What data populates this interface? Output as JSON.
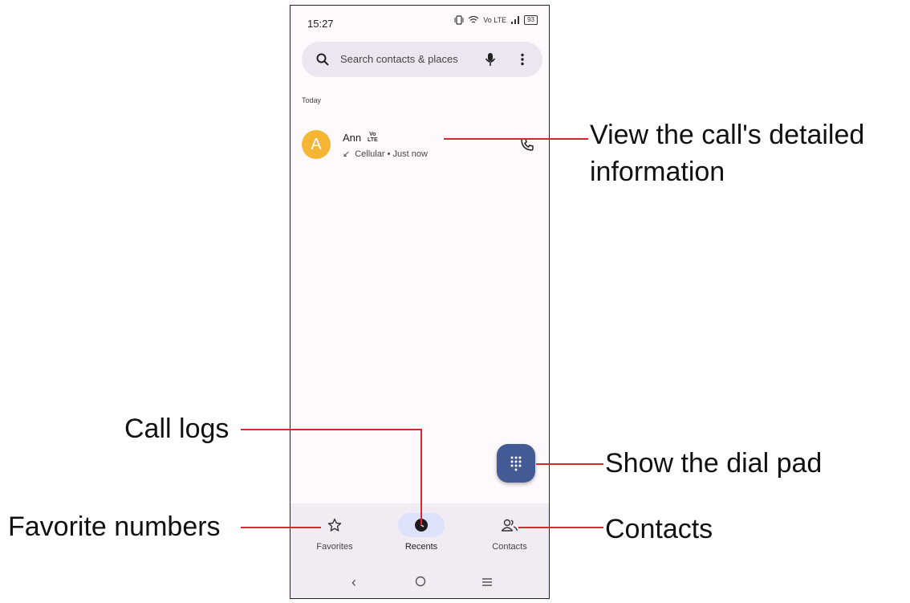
{
  "status_bar": {
    "time": "15:27",
    "battery": "93",
    "network": "Vo LTE"
  },
  "search": {
    "placeholder": "Search contacts & places"
  },
  "recents": {
    "section_label": "Today",
    "calls": [
      {
        "avatar_letter": "A",
        "name": "Ann",
        "badge_top": "Vo",
        "badge_bottom": "LTE",
        "detail": "Cellular • Just now",
        "avatar_color": "#f4b633"
      }
    ]
  },
  "nav": {
    "items": [
      {
        "label": "Favorites",
        "icon": "star-icon"
      },
      {
        "label": "Recents",
        "icon": "clock-icon",
        "active": true
      },
      {
        "label": "Contacts",
        "icon": "people-icon"
      }
    ]
  },
  "annotations": {
    "detail_line1": "View the call's detailed",
    "detail_line2": "information",
    "call_logs": "Call logs",
    "dial_pad": "Show the dial pad",
    "favorites": "Favorite numbers",
    "contacts": "Contacts"
  },
  "colors": {
    "fab": "#445a94",
    "annotation_line": "#d8262e",
    "active_pill": "#dce2f9",
    "avatar": "#f4b633"
  }
}
